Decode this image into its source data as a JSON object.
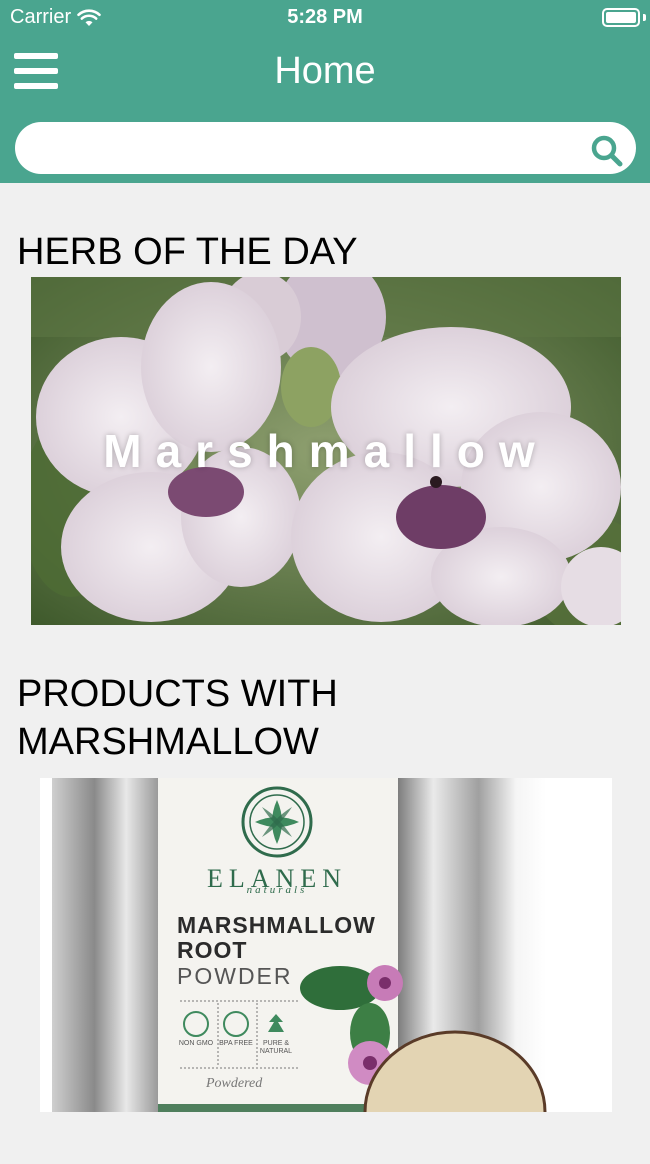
{
  "status_bar": {
    "carrier": "Carrier",
    "time": "5:28 PM"
  },
  "header": {
    "title": "Home"
  },
  "search": {
    "placeholder": "",
    "value": ""
  },
  "herb_section": {
    "heading": "HERB OF THE DAY",
    "herb_name": "Marshmallow"
  },
  "products_section": {
    "heading_line1": "PRODUCTS WITH",
    "heading_line2": "MARSHMALLOW",
    "product": {
      "brand": "ELANEN",
      "brand_sub": "naturals",
      "name_line1": "MARSHMALLOW",
      "name_line2": "ROOT",
      "name_line3": "POWDER",
      "badges": [
        {
          "icon": "non-gmo-icon",
          "label": "NON GMO"
        },
        {
          "icon": "bpa-free-icon",
          "label": "BPA FREE"
        },
        {
          "icon": "leaf-icon",
          "label": "PURE & NATURAL"
        }
      ],
      "form": "Powdered"
    }
  },
  "colors": {
    "header": "#4aa58f",
    "background": "#f0f0f0",
    "search_icon": "#4aa58f"
  }
}
